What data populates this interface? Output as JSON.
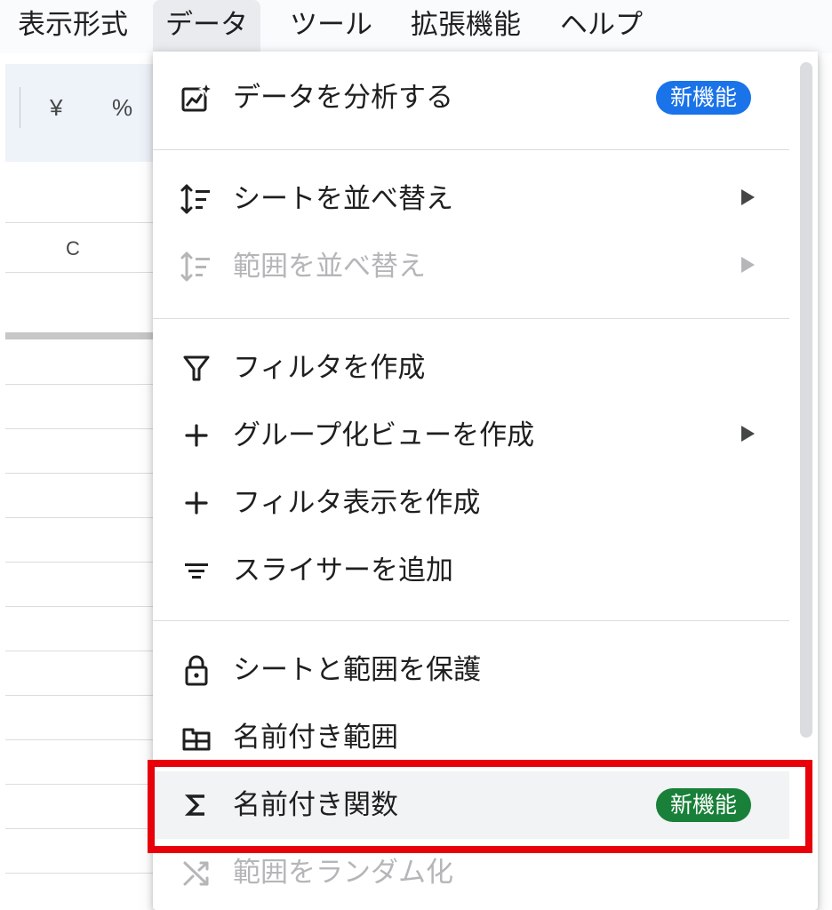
{
  "menubar": {
    "items": [
      "表示形式",
      "データ",
      "ツール",
      "拡張機能",
      "ヘルプ"
    ],
    "active_index": 1
  },
  "toolbar": {
    "currency": "¥",
    "percent": "%"
  },
  "grid": {
    "column_header": "C"
  },
  "menu": {
    "items": [
      {
        "label": "データを分析する",
        "icon": "analyze-data-icon",
        "badge": "新機能",
        "badge_color": "#1a73e8",
        "disabled": false,
        "submenu": false
      },
      {
        "label": "シートを並べ替え",
        "icon": "sort-icon",
        "disabled": false,
        "submenu": true
      },
      {
        "label": "範囲を並べ替え",
        "icon": "sort-icon",
        "disabled": true,
        "submenu": true
      },
      {
        "label": "フィルタを作成",
        "icon": "filter-icon",
        "disabled": false,
        "submenu": false
      },
      {
        "label": "グループ化ビューを作成",
        "icon": "plus-icon",
        "disabled": false,
        "submenu": true
      },
      {
        "label": "フィルタ表示を作成",
        "icon": "plus-icon",
        "disabled": false,
        "submenu": false
      },
      {
        "label": "スライサーを追加",
        "icon": "slicer-icon",
        "disabled": false,
        "submenu": false
      },
      {
        "label": "シートと範囲を保護",
        "icon": "lock-icon",
        "disabled": false,
        "submenu": false
      },
      {
        "label": "名前付き範囲",
        "icon": "named-range-icon",
        "disabled": false,
        "submenu": false
      },
      {
        "label": "名前付き関数",
        "icon": "sigma-icon",
        "badge": "新機能",
        "badge_color": "#188038",
        "disabled": false,
        "submenu": false,
        "highlighted": true
      },
      {
        "label": "範囲をランダム化",
        "icon": "shuffle-icon",
        "disabled": true,
        "submenu": false
      }
    ]
  },
  "colors": {
    "annotation_box": "#e8000b",
    "badge_blue": "#1a73e8",
    "badge_green": "#188038"
  }
}
